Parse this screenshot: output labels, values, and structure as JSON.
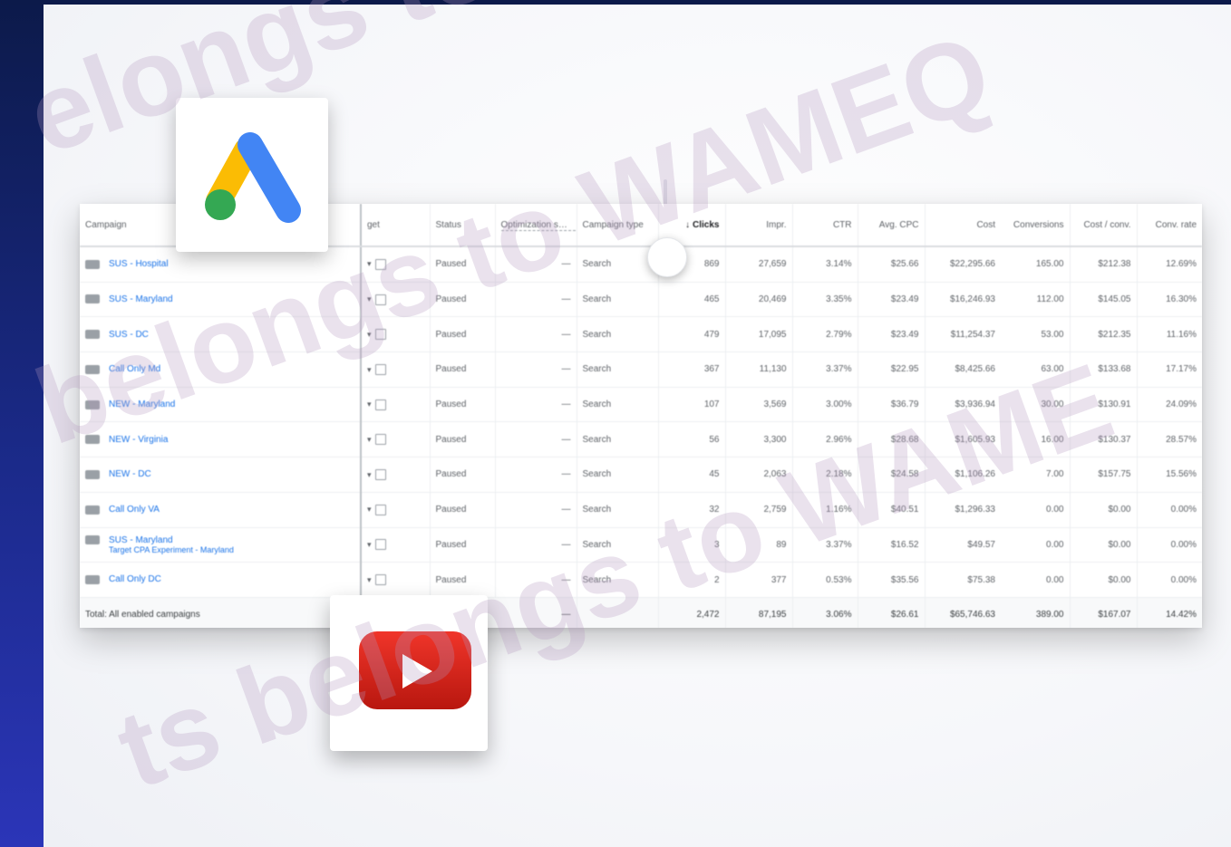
{
  "watermark": {
    "text_1": "elongs to WAMEQ.C",
    "text_2": "belongs to WAMEQ",
    "text_3": "ts belongs to WAME"
  },
  "colors": {
    "google_ads_blue": "#4285f4",
    "google_ads_yellow": "#fbbc04",
    "google_ads_green": "#34a853",
    "youtube_red": "#e62117",
    "link_blue": "#1a73e8"
  },
  "icons": {
    "ads_logo": "google-ads-logo",
    "youtube_logo": "youtube-play-logo"
  },
  "table": {
    "headers": {
      "campaign": "Campaign",
      "budget": "get",
      "status": "Status",
      "optimization": "Optimization score",
      "campaign_type": "Campaign type",
      "clicks": "Clicks",
      "impr": "Impr.",
      "ctr": "CTR",
      "avg_cpc": "Avg. CPC",
      "cost": "Cost",
      "conversions": "Conversions",
      "cost_conv": "Cost / conv.",
      "conv_rate": "Conv. rate"
    },
    "sort_arrow": "↓",
    "rows": [
      {
        "campaign": "SUS - Hospital",
        "sub": "",
        "status": "Paused",
        "opt": "—",
        "type": "Search",
        "clicks": "869",
        "impr": "27,659",
        "ctr": "3.14%",
        "cpc": "$25.66",
        "cost": "$22,295.66",
        "conv": "165.00",
        "cost_conv": "$212.38",
        "conv_rate": "12.69%"
      },
      {
        "campaign": "SUS - Maryland",
        "sub": "",
        "status": "Paused",
        "opt": "—",
        "type": "Search",
        "clicks": "465",
        "impr": "20,469",
        "ctr": "3.35%",
        "cpc": "$23.49",
        "cost": "$16,246.93",
        "conv": "112.00",
        "cost_conv": "$145.05",
        "conv_rate": "16.30%"
      },
      {
        "campaign": "SUS - DC",
        "sub": "",
        "status": "Paused",
        "opt": "—",
        "type": "Search",
        "clicks": "479",
        "impr": "17,095",
        "ctr": "2.79%",
        "cpc": "$23.49",
        "cost": "$11,254.37",
        "conv": "53.00",
        "cost_conv": "$212.35",
        "conv_rate": "11.16%"
      },
      {
        "campaign": "Call Only Md",
        "sub": "",
        "status": "Paused",
        "opt": "—",
        "type": "Search",
        "clicks": "367",
        "impr": "11,130",
        "ctr": "3.37%",
        "cpc": "$22.95",
        "cost": "$8,425.66",
        "conv": "63.00",
        "cost_conv": "$133.68",
        "conv_rate": "17.17%"
      },
      {
        "campaign": "NEW - Maryland",
        "sub": "",
        "status": "Paused",
        "opt": "—",
        "type": "Search",
        "clicks": "107",
        "impr": "3,569",
        "ctr": "3.00%",
        "cpc": "$36.79",
        "cost": "$3,936.94",
        "conv": "30.00",
        "cost_conv": "$130.91",
        "conv_rate": "24.09%"
      },
      {
        "campaign": "NEW - Virginia",
        "sub": "",
        "status": "Paused",
        "opt": "—",
        "type": "Search",
        "clicks": "56",
        "impr": "3,300",
        "ctr": "2.96%",
        "cpc": "$28.68",
        "cost": "$1,605.93",
        "conv": "16.00",
        "cost_conv": "$130.37",
        "conv_rate": "28.57%"
      },
      {
        "campaign": "NEW - DC",
        "sub": "",
        "status": "Paused",
        "opt": "—",
        "type": "Search",
        "clicks": "45",
        "impr": "2,063",
        "ctr": "2.18%",
        "cpc": "$24.58",
        "cost": "$1,106.26",
        "conv": "7.00",
        "cost_conv": "$157.75",
        "conv_rate": "15.56%"
      },
      {
        "campaign": "Call Only VA",
        "sub": "",
        "status": "Paused",
        "opt": "—",
        "type": "Search",
        "clicks": "32",
        "impr": "2,759",
        "ctr": "1.16%",
        "cpc": "$40.51",
        "cost": "$1,296.33",
        "conv": "0.00",
        "cost_conv": "$0.00",
        "conv_rate": "0.00%"
      },
      {
        "campaign": "SUS - Maryland",
        "sub": "Target CPA Experiment - Maryland",
        "status": "Paused",
        "opt": "—",
        "type": "Search",
        "clicks": "3",
        "impr": "89",
        "ctr": "3.37%",
        "cpc": "$16.52",
        "cost": "$49.57",
        "conv": "0.00",
        "cost_conv": "$0.00",
        "conv_rate": "0.00%"
      },
      {
        "campaign": "Call Only DC",
        "sub": "",
        "status": "Paused",
        "opt": "—",
        "type": "Search",
        "clicks": "2",
        "impr": "377",
        "ctr": "0.53%",
        "cpc": "$35.56",
        "cost": "$75.38",
        "conv": "0.00",
        "cost_conv": "$0.00",
        "conv_rate": "0.00%"
      }
    ],
    "total": {
      "label": "Total: All enabled campaigns",
      "opt": "—",
      "clicks": "2,472",
      "impr": "87,195",
      "ctr": "3.06%",
      "cpc": "$26.61",
      "cost": "$65,746.63",
      "conv": "389.00",
      "cost_conv": "$167.07",
      "conv_rate": "14.42%"
    }
  }
}
